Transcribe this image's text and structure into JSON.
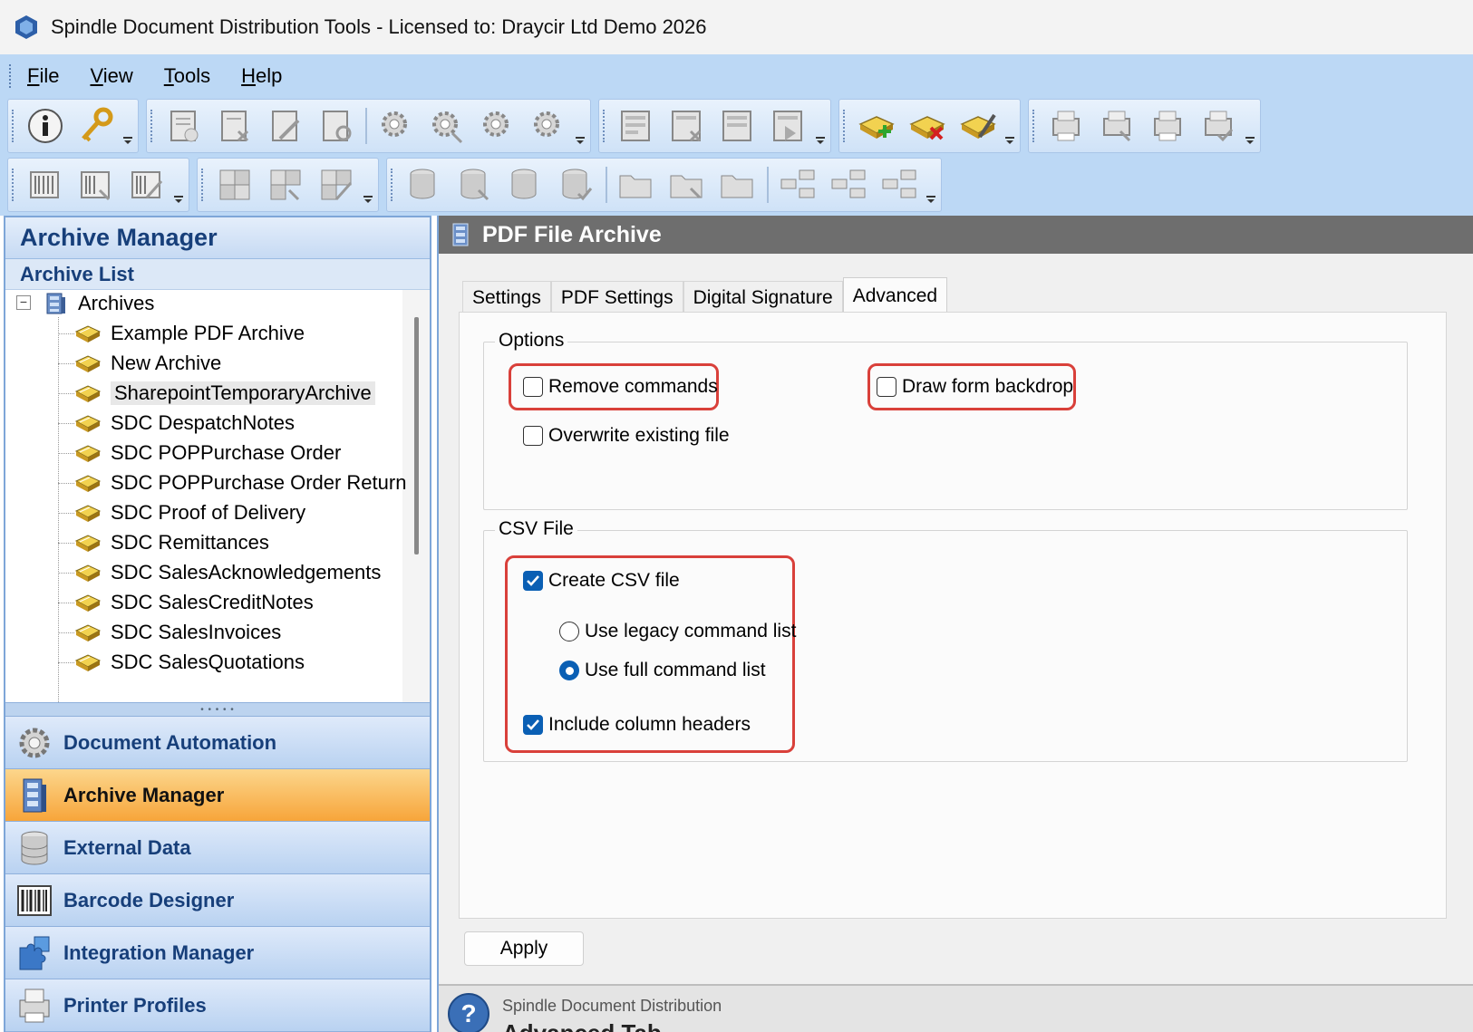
{
  "window": {
    "title": "Spindle Document Distribution Tools - Licensed to: Draycir Ltd Demo 2026"
  },
  "menu": [
    {
      "label": "File",
      "mnemonic": "F",
      "rest": "ile"
    },
    {
      "label": "View",
      "mnemonic": "V",
      "rest": "iew"
    },
    {
      "label": "Tools",
      "mnemonic": "T",
      "rest": "ools"
    },
    {
      "label": "Help",
      "mnemonic": "H",
      "rest": "elp"
    }
  ],
  "left_pane": {
    "header": "Archive Manager",
    "subheader": "Archive List",
    "tree_root": "Archives",
    "tree_items": [
      "Example PDF Archive",
      "New Archive",
      "SharepointTemporaryArchive",
      "SDC DespatchNotes",
      "SDC POPPurchase Order",
      "SDC POPPurchase Order Return",
      "SDC Proof of Delivery",
      "SDC Remittances",
      "SDC SalesAcknowledgements",
      "SDC SalesCreditNotes",
      "SDC SalesInvoices",
      "SDC SalesQuotations"
    ],
    "selected_item": "SharepointTemporaryArchive",
    "nav": [
      {
        "label": "Document Automation",
        "icon": "gear-icon",
        "active": false
      },
      {
        "label": "Archive Manager",
        "icon": "archive-cabinet-icon",
        "active": true
      },
      {
        "label": "External Data",
        "icon": "database-icon",
        "active": false
      },
      {
        "label": "Barcode Designer",
        "icon": "barcode-icon",
        "active": false
      },
      {
        "label": "Integration Manager",
        "icon": "puzzle-icon",
        "active": false
      },
      {
        "label": "Printer Profiles",
        "icon": "printer-icon",
        "active": false
      }
    ]
  },
  "right_pane": {
    "header": "PDF File Archive",
    "tabs": [
      "Settings",
      "PDF Settings",
      "Digital Signature",
      "Advanced"
    ],
    "active_tab": "Advanced",
    "options": {
      "title": "Options",
      "remove_commands": {
        "label": "Remove commands",
        "checked": false
      },
      "draw_form_backdrop": {
        "label": "Draw form backdrop",
        "checked": false
      },
      "overwrite_existing": {
        "label": "Overwrite existing file",
        "checked": false
      }
    },
    "csv": {
      "title": "CSV File",
      "create_csv": {
        "label": "Create CSV file",
        "checked": true
      },
      "legacy_list": {
        "label": "Use legacy command list",
        "selected": false
      },
      "full_list": {
        "label": "Use full command list",
        "selected": true
      },
      "column_headers": {
        "label": "Include column headers",
        "checked": true
      }
    },
    "apply_label": "Apply",
    "help": {
      "title": "Spindle Document Distribution",
      "subtitle": "Advanced Tab"
    }
  },
  "colors": {
    "accent_blue": "#0a5fb4",
    "highlight_red": "#d9403a",
    "nav_active_orange": "#f7a53a",
    "nav_text": "#173f7a"
  }
}
